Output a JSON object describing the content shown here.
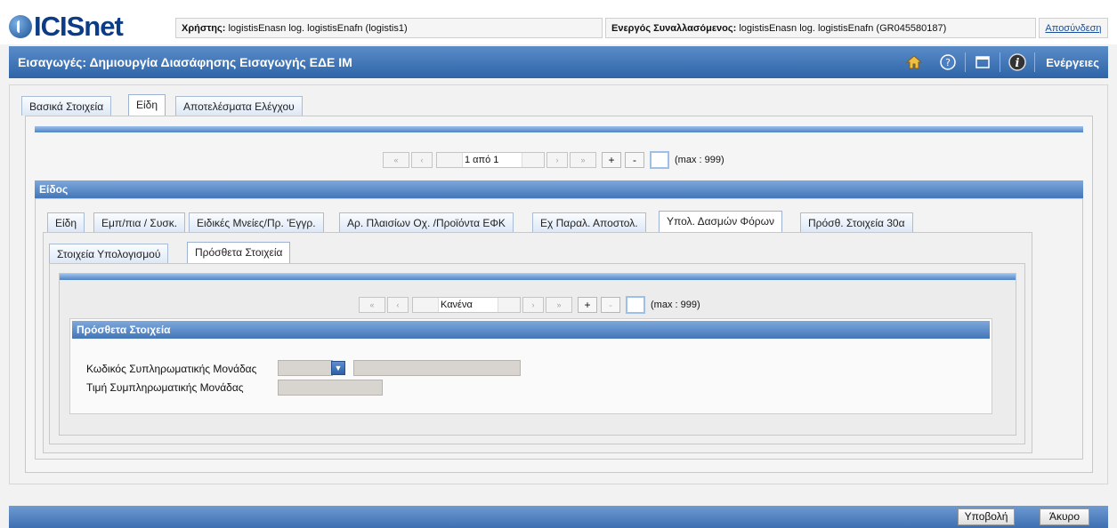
{
  "header": {
    "logo_text": "ICISnet",
    "user_label": "Χρήστης:",
    "user_value": "logistisEnasn log. logistisEnafn (logistis1)",
    "trader_label": "Ενεργός Συναλλασόμενος:",
    "trader_value": "logistisEnasn log. logistisEnafn (GR045580187)",
    "logout": "Αποσύνδεση"
  },
  "titlebar": {
    "title": "Εισαγωγές: Δημιουργία Διασάφησης Εισαγωγής ΕΔΕ ΙΜ",
    "actions": "Ενέργειες",
    "icons": [
      "home-icon",
      "help-icon",
      "window-icon",
      "info-icon"
    ]
  },
  "main_tabs": [
    "Βασικά Στοιχεία",
    "Είδη",
    "Αποτελέσματα Ελέγχου"
  ],
  "pager1": {
    "nav": [
      "«",
      "‹",
      "›",
      "»"
    ],
    "text": "1 από 1",
    "plus": "+",
    "minus": "-",
    "max": "(max : 999)"
  },
  "section_eidos": "Είδος",
  "item_tabs": [
    "Είδη",
    "Εμπ/πια / Συσκ.",
    "Ειδικές Μνείες/Πρ. 'Εγγρ.",
    "Αρ. Πλαισίων Οχ. /Προϊόντα ΕΦΚ",
    "Εχ Παραλ. Αποστολ.",
    "Υπολ. Δασμών Φόρων",
    "Πρόσθ. Στοιχεία 30α"
  ],
  "calc_tabs": [
    "Στοιχεία Υπολογισμού",
    "Πρόσθετα Στοιχεία"
  ],
  "pager2": {
    "text": "Κανένα",
    "plus": "+",
    "minus": "-",
    "max": "(max : 999)"
  },
  "section_extra": "Πρόσθετα Στοιχεία",
  "form": {
    "code_label": "Κωδικός Συπληρωματικής Μονάδας",
    "price_label": "Τιμή Συμπληρωματικής Μονάδας"
  },
  "footer": {
    "submit": "Υποβολή",
    "cancel": "Άκυρο"
  },
  "colors": {
    "brand": "#0c3c86",
    "bar": "#2e64a8"
  }
}
